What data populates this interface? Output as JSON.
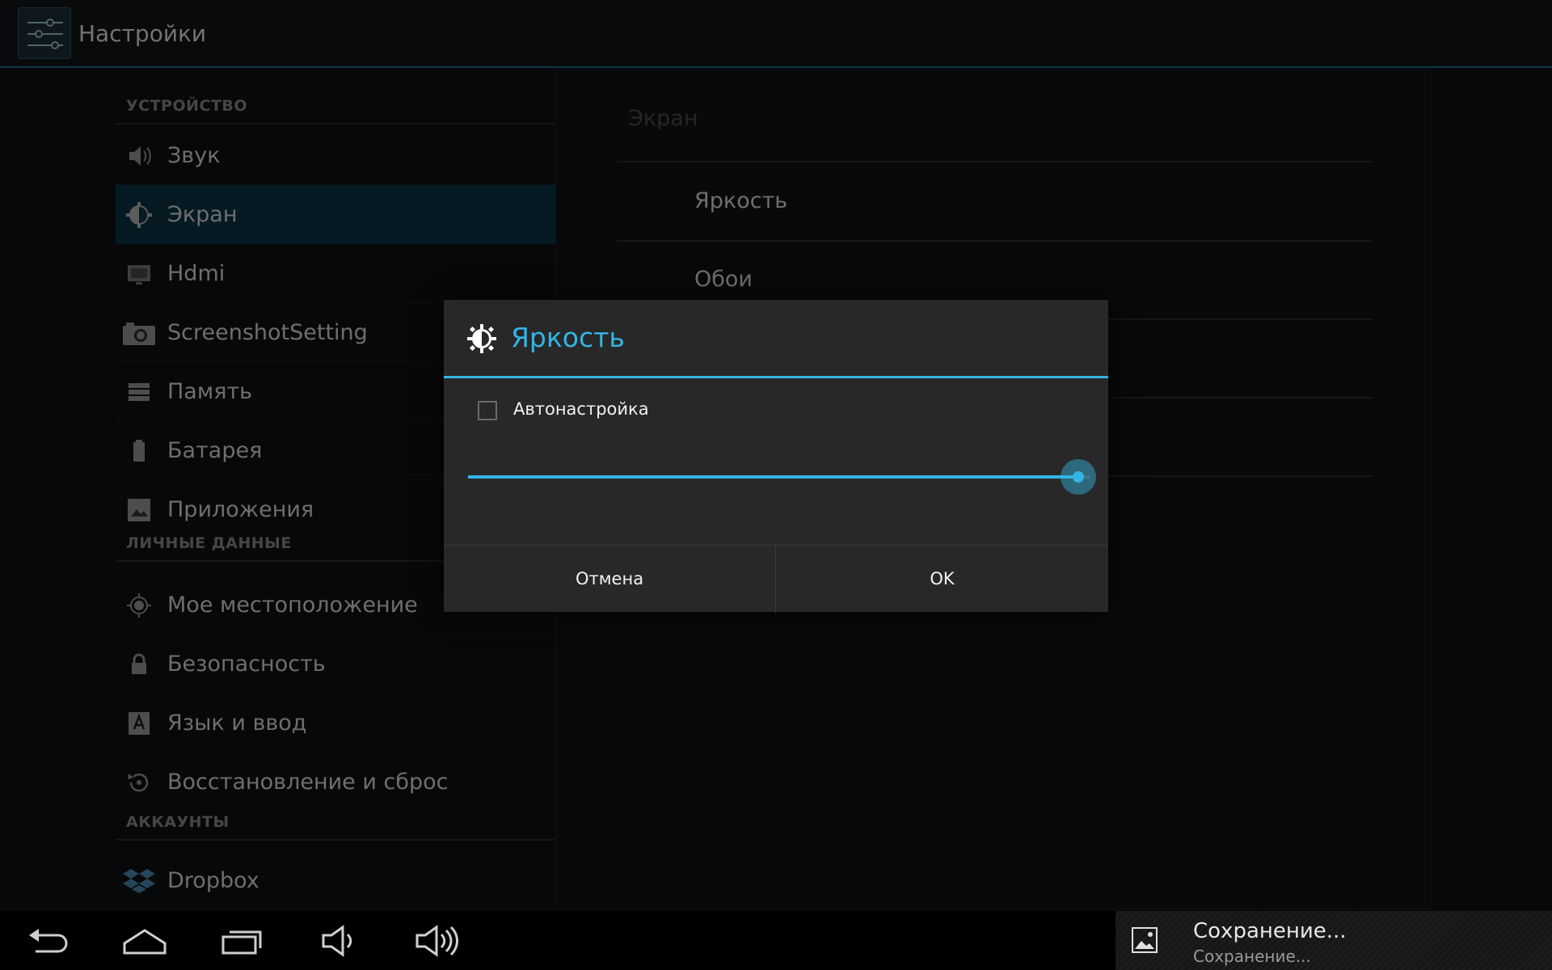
{
  "action_bar": {
    "title": "Настройки",
    "icon": "settings-sliders-icon"
  },
  "nav": {
    "sections": [
      {
        "header": "УСТРОЙСТВО",
        "items": [
          {
            "label": "Звук",
            "icon": "speaker-icon"
          },
          {
            "label": "Экран",
            "icon": "brightness-icon",
            "selected": true
          },
          {
            "label": "Hdmi",
            "icon": "hdmi-icon"
          },
          {
            "label": "ScreenshotSetting",
            "icon": "camera-icon"
          },
          {
            "label": "Память",
            "icon": "storage-icon"
          },
          {
            "label": "Батарея",
            "icon": "battery-icon"
          },
          {
            "label": "Приложения",
            "icon": "apps-icon"
          }
        ]
      },
      {
        "header": "ЛИЧНЫЕ ДАННЫЕ",
        "items": [
          {
            "label": "Мое местоположение",
            "icon": "location-icon"
          },
          {
            "label": "Безопасность",
            "icon": "lock-icon"
          },
          {
            "label": "Язык и ввод",
            "icon": "language-icon"
          },
          {
            "label": "Восстановление и сброс",
            "icon": "restore-icon"
          }
        ]
      },
      {
        "header": "АККАУНТЫ",
        "items": [
          {
            "label": "Dropbox",
            "icon": "dropbox-icon"
          }
        ]
      }
    ]
  },
  "detail": {
    "title": "Экран",
    "items": [
      "Яркость",
      "Обои"
    ]
  },
  "dialog": {
    "title": "Яркость",
    "icon": "brightness-icon",
    "auto_label": "Автонастройка",
    "auto_checked": false,
    "brightness_fraction": 0.98,
    "cancel_label": "Отмена",
    "ok_label": "OK"
  },
  "system_bar": {
    "buttons": [
      "back-icon",
      "home-icon",
      "recent-apps-icon",
      "volume-down-icon",
      "volume-up-icon"
    ],
    "notification": {
      "title": "Сохранение...",
      "text": "Сохранение...",
      "icon": "image-icon"
    }
  },
  "colors": {
    "accent": "#33b5e5",
    "selected_bg": "#0a3447"
  }
}
